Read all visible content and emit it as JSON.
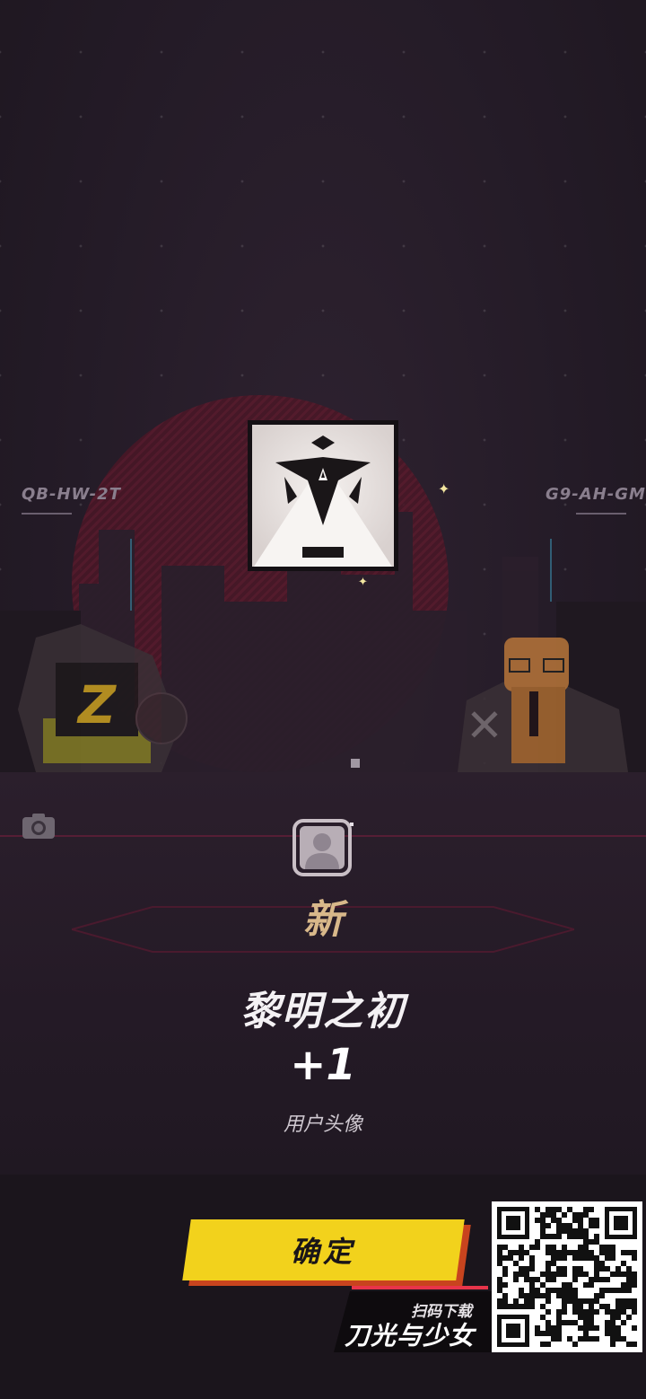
{
  "scene": {
    "left_tag": "QB-HW-2T",
    "right_tag": "G9-AH-GM"
  },
  "reward": {
    "new_label": "新",
    "item_name": "黎明之初",
    "item_count": "+1",
    "item_type": "用户头像"
  },
  "actions": {
    "confirm_label": "确定"
  },
  "promo": {
    "scan_label": "扫码下载",
    "game_title": "刀光与少女"
  },
  "colors": {
    "accent_yellow": "#f2d21c",
    "accent_red": "#c8441e",
    "new_gold": "#d8b88a",
    "background": "#231a26"
  },
  "icons": [
    "camera-icon",
    "avatar-placeholder-icon",
    "sparkle-icon",
    "qr-code"
  ]
}
